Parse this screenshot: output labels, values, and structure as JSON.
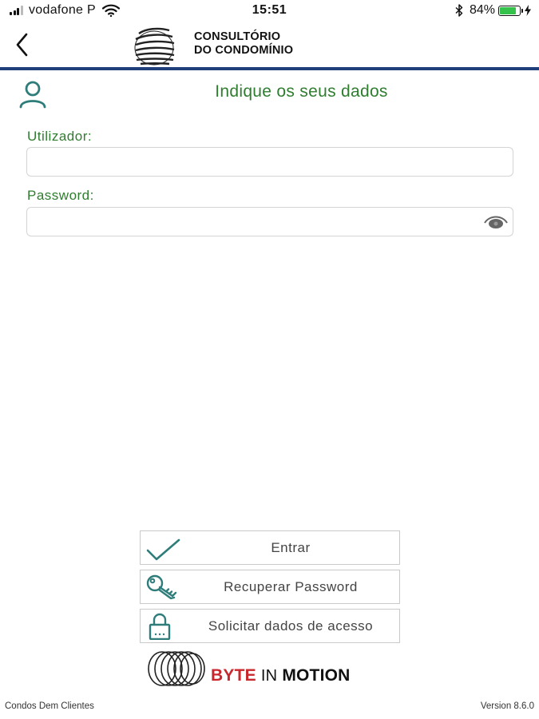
{
  "status_bar": {
    "carrier": "vodafone P",
    "time": "15:51",
    "battery_percent": "84%",
    "battery_level": 0.84,
    "icons": [
      "signal-icon",
      "wifi-icon",
      "bluetooth-icon",
      "battery-icon",
      "charging-icon"
    ]
  },
  "header": {
    "brand_line1": "CONSULTÓRIO",
    "brand_line2": "DO CONDOMÍNIO",
    "back_icon": "chevron-left-icon",
    "accent_color": "#1f3f7a"
  },
  "main": {
    "title": "Indique os seus dados",
    "title_color": "#2f7d2f",
    "user_icon": "user-icon"
  },
  "form": {
    "username_label": "Utilizador:",
    "username_value": "",
    "password_label": "Password:",
    "password_value": "",
    "eye_icon": "eye-icon"
  },
  "actions": [
    {
      "label": "Entrar",
      "icon": "checkmark-icon"
    },
    {
      "label": "Recuperar Password",
      "icon": "key-icon"
    },
    {
      "label": "Solicitar dados de acesso",
      "icon": "lock-icon"
    }
  ],
  "branding": {
    "part1": "BYTE",
    "part2": "IN",
    "part3": "MOTION",
    "red_color": "#c8282d"
  },
  "footer": {
    "left_text": "Condos Dem Clientes",
    "version": "Version 8.6.0"
  }
}
